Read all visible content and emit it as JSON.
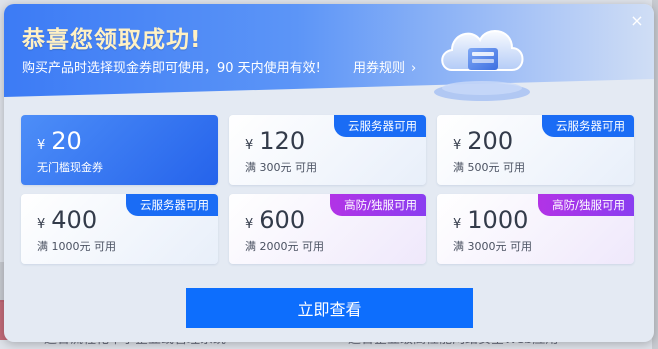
{
  "background": {
    "text_left": "适合流程化中小企业或管理系统",
    "text_right": "适合企业级高性能网络安全Web应用"
  },
  "modal": {
    "title": "恭喜您领取成功!",
    "subtitle": "购买产品时选择现金券即可使用，90 天内使用有效!",
    "rules_link": "用券规则",
    "rules_chevron": "›",
    "close_icon": "×"
  },
  "coupons": [
    {
      "currency": "¥",
      "amount": "20",
      "condition": "无门槛现金券",
      "tag": "",
      "style": "primary"
    },
    {
      "currency": "¥",
      "amount": "120",
      "condition": "满 300元 可用",
      "tag": "云服务器可用",
      "style": "blue"
    },
    {
      "currency": "¥",
      "amount": "200",
      "condition": "满 500元 可用",
      "tag": "云服务器可用",
      "style": "blue"
    },
    {
      "currency": "¥",
      "amount": "400",
      "condition": "满 1000元 可用",
      "tag": "云服务器可用",
      "style": "blue"
    },
    {
      "currency": "¥",
      "amount": "600",
      "condition": "满 2000元 可用",
      "tag": "高防/独服可用",
      "style": "purple"
    },
    {
      "currency": "¥",
      "amount": "1000",
      "condition": "满 3000元 可用",
      "tag": "高防/独服可用",
      "style": "purple"
    }
  ],
  "cta": {
    "label": "立即查看"
  },
  "colors": {
    "primary": "#0d6efd",
    "tag_blue": "#1a6cf5",
    "tag_purple": "#9b38ec",
    "title": "#fff1c4"
  }
}
